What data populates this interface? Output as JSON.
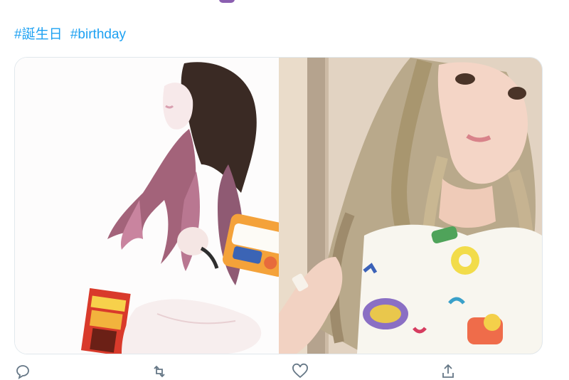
{
  "tweet": {
    "hashtags": [
      "#誕生日",
      "#birthday"
    ]
  },
  "media": {
    "images": [
      {
        "name": "photo-left",
        "alt": ""
      },
      {
        "name": "photo-right",
        "alt": ""
      }
    ]
  },
  "actions": {
    "reply_icon": "reply-icon",
    "retweet_icon": "retweet-icon",
    "like_icon": "heart-icon",
    "share_icon": "share-icon"
  },
  "colors": {
    "link": "#1da1f2",
    "muted": "#657786",
    "border": "#e1e8ed"
  }
}
